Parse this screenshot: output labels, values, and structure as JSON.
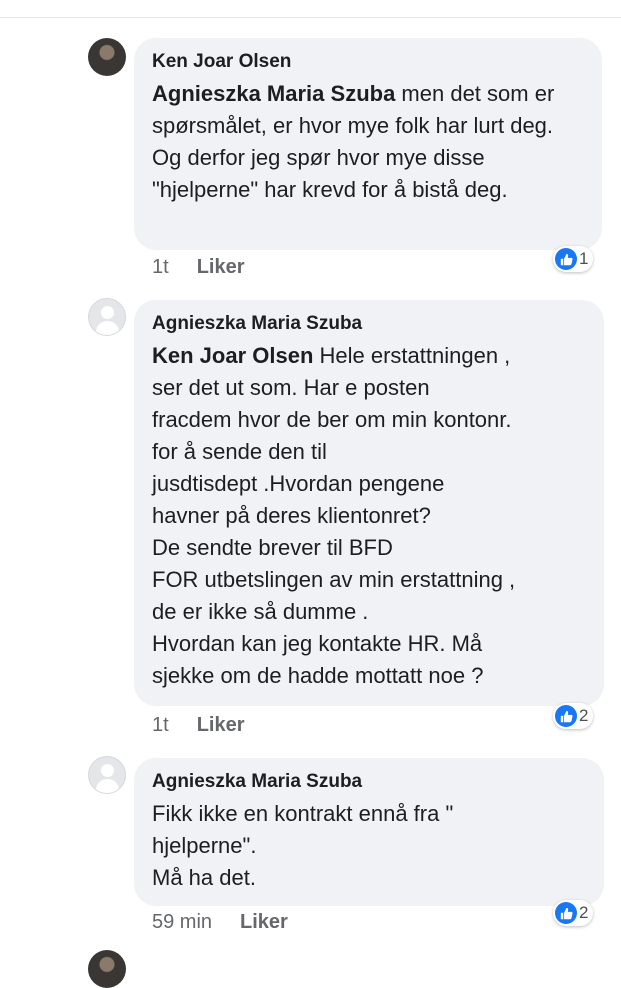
{
  "comments": [
    {
      "author": "Ken Joar Olsen",
      "mention": "Agnieszka Maria Szuba",
      "text": " men det som er spørsmålet, er hvor mye folk har lurt deg. Og derfor jeg spør hvor mye disse \"hjelperne\" har krevd for å bistå deg.",
      "time": "1t",
      "action": "Liker",
      "reaction_count": "1"
    },
    {
      "author": "Agnieszka Maria Szuba",
      "mention": "Ken Joar Olsen",
      "text": " Hele erstattningen ,\nser det ut som. Har e posten\nfracdem hvor de ber om min kontonr.\nfor å sende den til\njusdtisdept .Hvordan pengene\nhavner på deres klientonret?\nDe sendte brever til BFD\nFOR utbetslingen av min erstattning ,\nde er ikke så dumme .\nHvordan kan jeg kontakte HR. Må\nsjekke om de hadde mottatt noe ?",
      "time": "1t",
      "action": "Liker",
      "reaction_count": "2"
    },
    {
      "author": "Agnieszka Maria Szuba",
      "text": "Fikk ikke en kontrakt ennå fra \"\nhjelperne\".\nMå ha det.",
      "time": "59 min",
      "action": "Liker",
      "reaction_count": "2"
    }
  ],
  "icons": {
    "reaction": "thumbs-up-icon",
    "avatar_default": "default-avatar-icon"
  },
  "colors": {
    "bubble": "#f0f2f5",
    "like_blue": "#1877f2",
    "meta_gray": "#65676b"
  }
}
